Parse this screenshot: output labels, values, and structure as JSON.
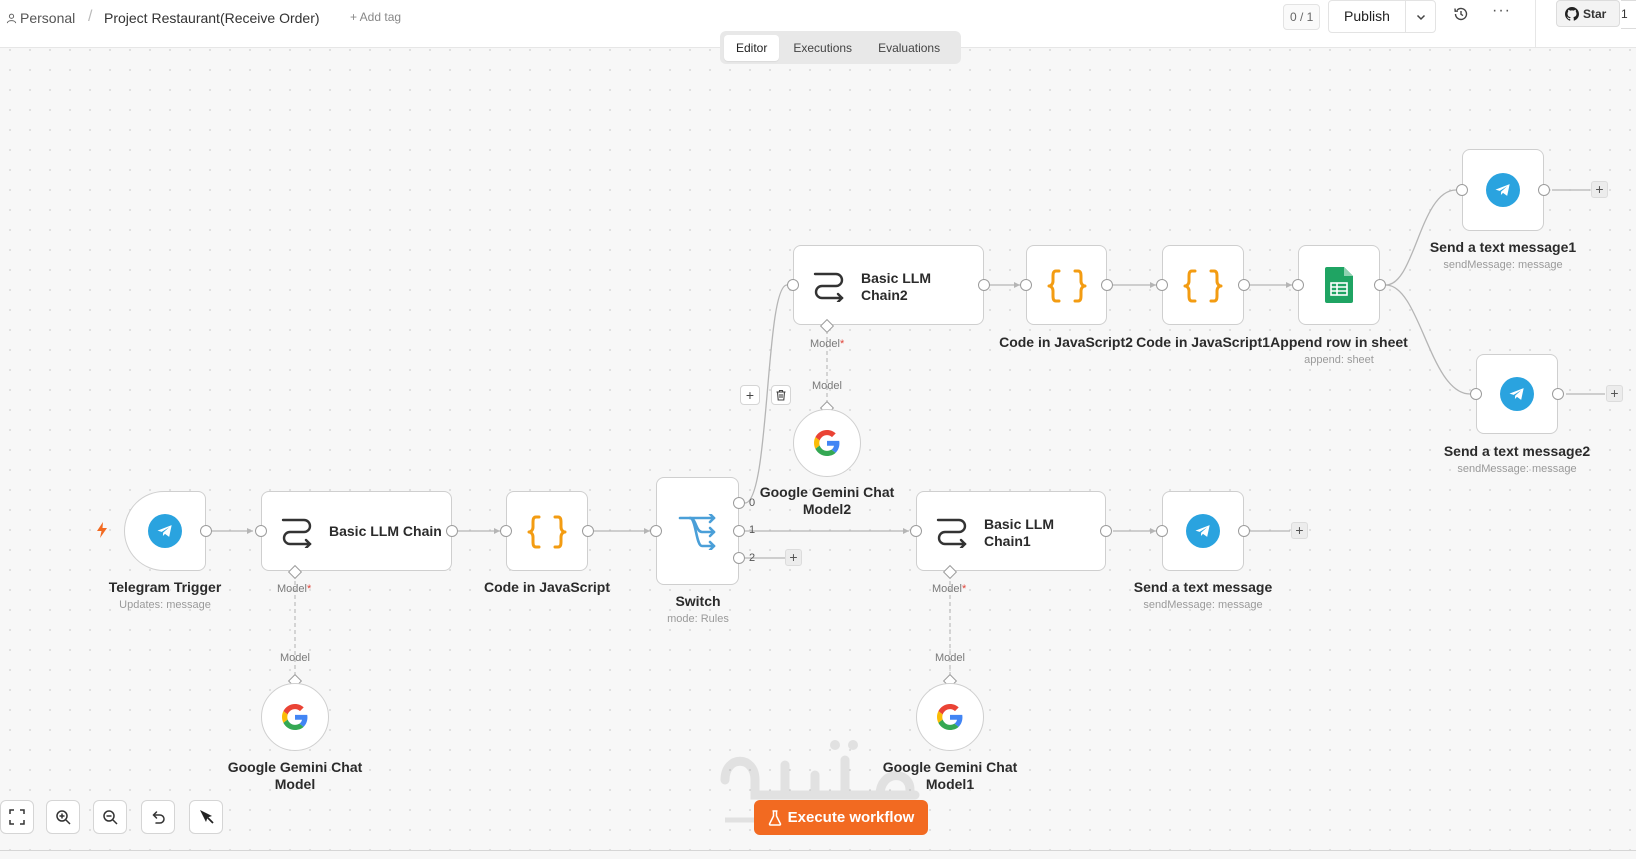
{
  "header": {
    "workspace": "Personal",
    "separator": "/",
    "project_title": "Project Restaurant(Receive Order)",
    "add_tag": "+ Add tag",
    "counter": "0 / 1",
    "publish_label": "Publish",
    "more": "···",
    "star_label": "Star",
    "star_count": "1"
  },
  "tabs": [
    {
      "label": "Editor",
      "active": true
    },
    {
      "label": "Executions",
      "active": false
    },
    {
      "label": "Evaluations",
      "active": false
    }
  ],
  "nodes": {
    "telegram_trigger": {
      "name": "Telegram Trigger",
      "subtitle": "Updates: message"
    },
    "basic_llm_chain": {
      "name": "Basic LLM Chain",
      "port_label": "Model"
    },
    "gemini_model": {
      "name_line1": "Google Gemini Chat",
      "name_line2": "Model",
      "port_label": "Model"
    },
    "code_js": {
      "name": "Code in JavaScript"
    },
    "switch": {
      "name": "Switch",
      "subtitle": "mode: Rules",
      "outputs": [
        "0",
        "1",
        "2"
      ]
    },
    "basic_llm_chain2": {
      "name_line1": "Basic LLM",
      "name_line2": "Chain2",
      "port_label": "Model"
    },
    "gemini_model2": {
      "name_line1": "Google Gemini Chat",
      "name_line2": "Model2",
      "port_label": "Model"
    },
    "code_js2": {
      "name": "Code in JavaScript2"
    },
    "code_js1": {
      "name": "Code in JavaScript1"
    },
    "append_row": {
      "name": "Append row in sheet",
      "subtitle": "append: sheet"
    },
    "send_msg1": {
      "name": "Send a text message1",
      "subtitle": "sendMessage: message"
    },
    "send_msg2": {
      "name": "Send a text message2",
      "subtitle": "sendMessage: message"
    },
    "basic_llm_chain1": {
      "name_line1": "Basic LLM",
      "name_line2": "Chain1",
      "port_label": "Model"
    },
    "gemini_model1": {
      "name_line1": "Google Gemini Chat",
      "name_line2": "Model1",
      "port_label": "Model"
    },
    "send_msg": {
      "name": "Send a text message",
      "subtitle": "sendMessage: message"
    }
  },
  "required_mark": "*",
  "execute_button": "Execute workflow",
  "colors": {
    "accent": "#f26a21",
    "telegram": "#2aa3df",
    "code_braces": "#f39c12",
    "switch": "#4a9fd8",
    "sheets": "#1fa463"
  }
}
